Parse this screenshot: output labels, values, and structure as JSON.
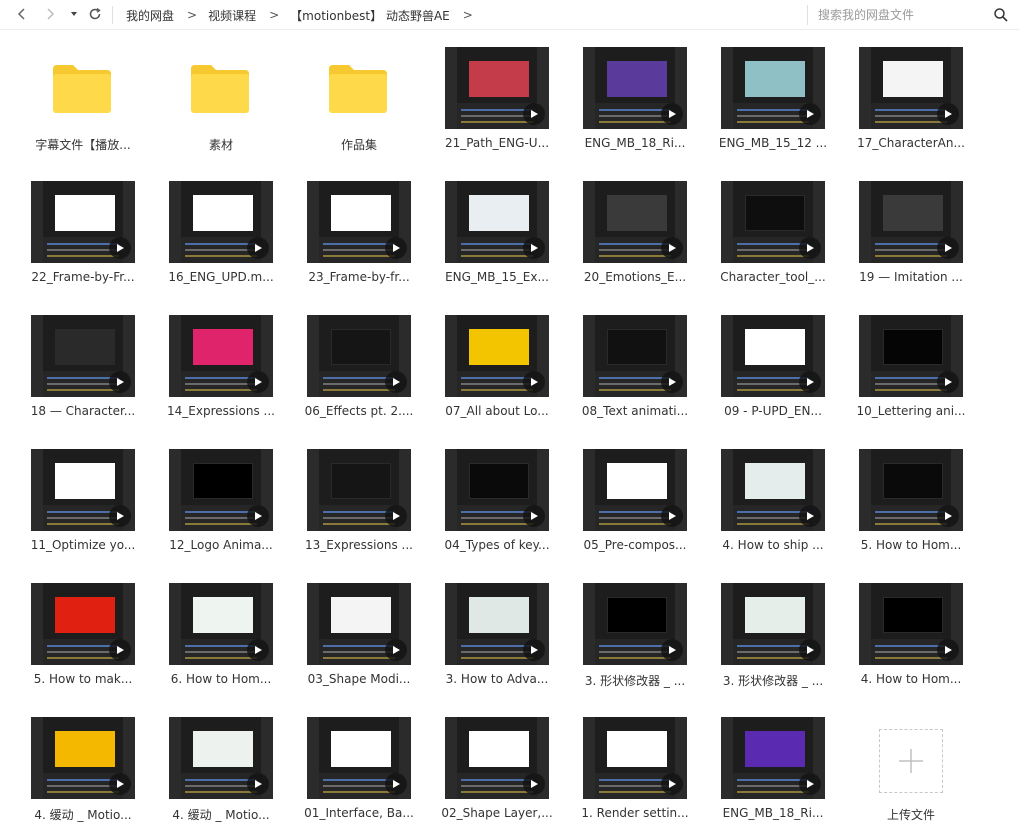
{
  "nav": {
    "back_icon": "chevron-left-icon",
    "forward_icon": "chevron-right-icon",
    "history_icon": "caret-down-icon",
    "refresh_icon": "refresh-icon"
  },
  "breadcrumb": [
    "我的网盘",
    "视频课程",
    "【motionbest】 动态野兽AE"
  ],
  "breadcrumb_sep": ">",
  "search": {
    "placeholder": "搜索我的网盘文件",
    "value": ""
  },
  "items": [
    {
      "label": "字幕文件【播放...",
      "kind": "folder"
    },
    {
      "label": "素材",
      "kind": "folder"
    },
    {
      "label": "作品集",
      "kind": "folder"
    },
    {
      "label": "21_Path_ENG-U...",
      "kind": "video",
      "accent": "#c43c4a"
    },
    {
      "label": "ENG_MB_18_Ri...",
      "kind": "video",
      "accent": "#5a3a9a"
    },
    {
      "label": "ENG_MB_15_12 ...",
      "kind": "video",
      "accent": "#8fc0c6"
    },
    {
      "label": "17_CharacterAn...",
      "kind": "video",
      "accent": "#f4f4f4"
    },
    {
      "label": "22_Frame-by-Fr...",
      "kind": "video",
      "accent": "#ffffff"
    },
    {
      "label": "16_ENG_UPD.m...",
      "kind": "video",
      "accent": "#ffffff"
    },
    {
      "label": "23_Frame-by-fr...",
      "kind": "video",
      "accent": "#ffffff"
    },
    {
      "label": "ENG_MB_15_Ex...",
      "kind": "video",
      "accent": "#e8eef2"
    },
    {
      "label": "20_Emotions_E...",
      "kind": "video",
      "accent": "#3a3a3a"
    },
    {
      "label": "Character_tool_...",
      "kind": "video",
      "accent": "#0e0e0e"
    },
    {
      "label": "19 — Imitation ...",
      "kind": "video",
      "accent": "#3a3a3a"
    },
    {
      "label": "18 — Character...",
      "kind": "video",
      "accent": "#2a2a2a"
    },
    {
      "label": "14_Expressions ...",
      "kind": "video",
      "accent": "#e0246c"
    },
    {
      "label": "06_Effects pt. 2....",
      "kind": "video",
      "accent": "#151515"
    },
    {
      "label": "07_All about Lo...",
      "kind": "video",
      "accent": "#f2c500"
    },
    {
      "label": "08_Text animati...",
      "kind": "video",
      "accent": "#111111"
    },
    {
      "label": "09 - P-UPD_EN...",
      "kind": "video",
      "accent": "#ffffff"
    },
    {
      "label": "10_Lettering ani...",
      "kind": "video",
      "accent": "#050505"
    },
    {
      "label": "11_Optimize yo...",
      "kind": "video",
      "accent": "#ffffff"
    },
    {
      "label": "12_Logo Anima...",
      "kind": "video",
      "accent": "#000000"
    },
    {
      "label": "13_Expressions ...",
      "kind": "video",
      "accent": "#151515"
    },
    {
      "label": "04_Types of key...",
      "kind": "video",
      "accent": "#0a0a0a"
    },
    {
      "label": "05_Pre-compos...",
      "kind": "video",
      "accent": "#ffffff"
    },
    {
      "label": "4. How to ship ...",
      "kind": "video",
      "accent": "#e4ecec"
    },
    {
      "label": "5. How to Hom...",
      "kind": "video",
      "accent": "#0a0a0a"
    },
    {
      "label": "5. How to mak...",
      "kind": "video",
      "accent": "#e02010"
    },
    {
      "label": "6. How to Hom...",
      "kind": "video",
      "accent": "#eef4f0"
    },
    {
      "label": "03_Shape Modi...",
      "kind": "video",
      "accent": "#f4f4f4"
    },
    {
      "label": "3. How to Adva...",
      "kind": "video",
      "accent": "#dfe8e4"
    },
    {
      "label": "3. 形状修改器 _ ...",
      "kind": "video",
      "accent": "#000000"
    },
    {
      "label": "3. 形状修改器 _ ...",
      "kind": "video",
      "accent": "#e6eeea"
    },
    {
      "label": "4. How to Hom...",
      "kind": "video",
      "accent": "#000000"
    },
    {
      "label": "4. 缓动 _ Motio...",
      "kind": "video",
      "accent": "#f4b800"
    },
    {
      "label": "4. 缓动 _ Motio...",
      "kind": "video",
      "accent": "#eef2ee"
    },
    {
      "label": "01_Interface, Ba...",
      "kind": "video",
      "accent": "#ffffff"
    },
    {
      "label": "02_Shape Layer,...",
      "kind": "video",
      "accent": "#ffffff"
    },
    {
      "label": "1. Render settin...",
      "kind": "video",
      "accent": "#ffffff"
    },
    {
      "label": "ENG_MB_18_Ri...",
      "kind": "video",
      "accent": "#5a2ab0"
    },
    {
      "label": "上传文件",
      "kind": "upload"
    }
  ]
}
